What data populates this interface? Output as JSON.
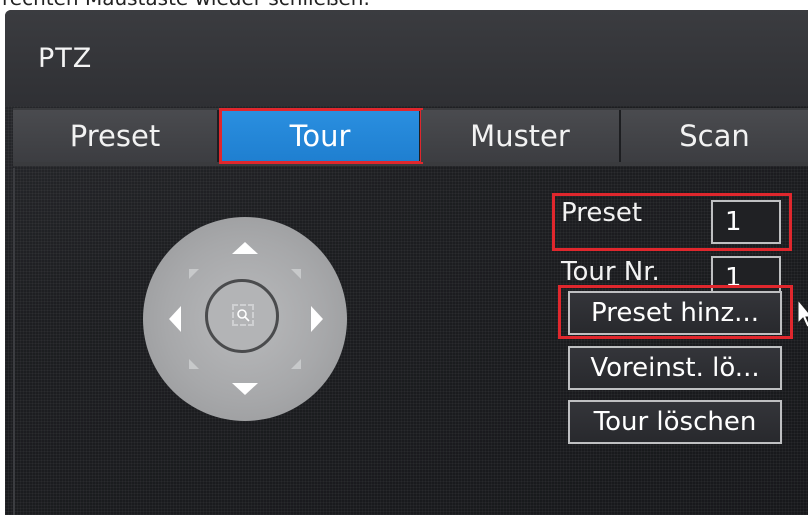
{
  "caption": {
    "text": "rechten Maustaste wieder schließen."
  },
  "window": {
    "title": "PTZ"
  },
  "tabs": [
    {
      "label": "Preset",
      "active": false
    },
    {
      "label": "Tour",
      "active": true
    },
    {
      "label": "Muster",
      "active": false
    },
    {
      "label": "Scan",
      "active": false
    }
  ],
  "joystick": {
    "icons": [
      "arrow-up-icon",
      "arrow-down-icon",
      "arrow-left-icon",
      "arrow-right-icon",
      "zoom-center-icon"
    ]
  },
  "form": {
    "preset": {
      "label": "Preset",
      "value": "1"
    },
    "tour_nr": {
      "label": "Tour Nr.",
      "value": "1"
    }
  },
  "buttons": {
    "add_preset": "Preset hinz...",
    "delete_preset": "Voreinst. lö...",
    "delete_tour": "Tour löschen"
  },
  "colors": {
    "accent_blue": "#1f7fd0",
    "highlight_red": "#e0272d",
    "panel_dark": "#1c1d20"
  }
}
